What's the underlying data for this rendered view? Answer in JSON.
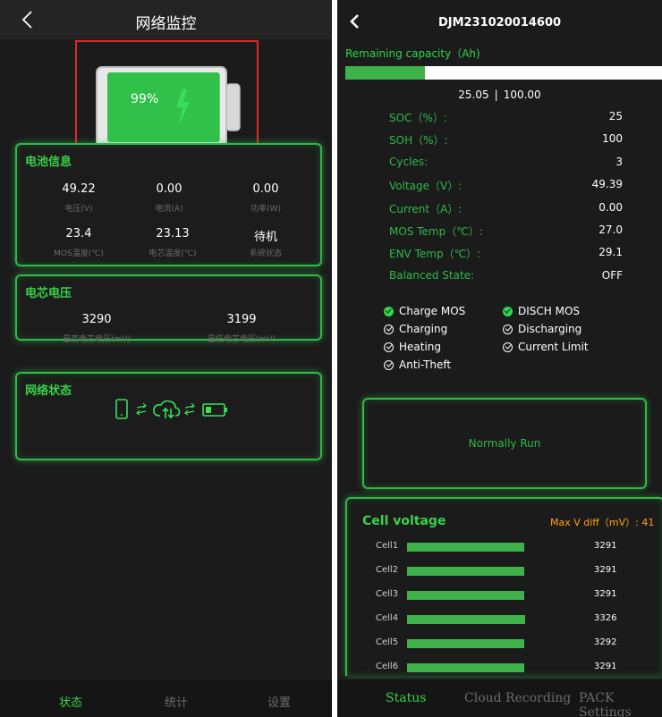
{
  "left": {
    "header": {
      "title": "网络监控"
    },
    "battery": {
      "percent_text": "99%",
      "fill_fraction": 0.99
    },
    "battery_info": {
      "title": "电池信息",
      "items": [
        {
          "value": "49.22",
          "label": "电压(V)"
        },
        {
          "value": "0.00",
          "label": "电流(A)"
        },
        {
          "value": "0.00",
          "label": "功率(W)"
        },
        {
          "value": "23.4",
          "label": "MOS温度(℃)"
        },
        {
          "value": "23.13",
          "label": "电芯温度(℃)"
        },
        {
          "value": "待机",
          "label": "系统状态"
        }
      ]
    },
    "cell_voltage": {
      "title": "电芯电压",
      "items": [
        {
          "value": "3290",
          "label": "最高电芯电压(mV)"
        },
        {
          "value": "3199",
          "label": "最低电芯电压(mV)"
        }
      ]
    },
    "network": {
      "title": "网络状态",
      "icons": [
        "phone-icon",
        "arrows-icon",
        "cloud-sync-icon",
        "arrows-icon",
        "battery-icon"
      ]
    },
    "tabs": [
      {
        "label": "状态",
        "active": true
      },
      {
        "label": "统计",
        "active": false
      },
      {
        "label": "设置",
        "active": false
      }
    ]
  },
  "right": {
    "header": {
      "title": "DJM231020014600"
    },
    "remaining": {
      "label": "Remaining capacity（Ah)",
      "current": "25.05",
      "separator": "|",
      "total": "100.00",
      "fraction": 0.25
    },
    "metrics": [
      {
        "label": "SOC（%）:",
        "value": "25"
      },
      {
        "label": "SOH（%）:",
        "value": "100"
      },
      {
        "label": "Cycles:",
        "value": "3"
      },
      {
        "label": "Voltage（V）:",
        "value": "49.39"
      },
      {
        "label": "Current（A）:",
        "value": "0.00"
      },
      {
        "label": "MOS Temp（℃）:",
        "value": "27.0"
      },
      {
        "label": "ENV Temp（℃）:",
        "value": "29.1"
      },
      {
        "label": "Balanced State:",
        "value": "OFF"
      }
    ],
    "flags": [
      {
        "label": "Charge MOS",
        "on": true
      },
      {
        "label": "DISCH MOS",
        "on": true
      },
      {
        "label": "Charging",
        "on": false
      },
      {
        "label": "Discharging",
        "on": false
      },
      {
        "label": "Heating",
        "on": false
      },
      {
        "label": "Current Limit",
        "on": false
      },
      {
        "label": "Anti-Theft",
        "on": false
      }
    ],
    "run_status": "Normally Run",
    "cell_voltage": {
      "title": "Cell voltage",
      "max_diff": "Max V diff（mV）: 41",
      "cells": [
        {
          "name": "Cell1",
          "value": "3291"
        },
        {
          "name": "Cell2",
          "value": "3291"
        },
        {
          "name": "Cell3",
          "value": "3291"
        },
        {
          "name": "Cell4",
          "value": "3326"
        },
        {
          "name": "Cell5",
          "value": "3292"
        },
        {
          "name": "Cell6",
          "value": "3291"
        }
      ]
    },
    "tabs": [
      {
        "label": "Status",
        "active": true
      },
      {
        "label": "Cloud Recording",
        "active": false
      },
      {
        "label": "PACK Settings",
        "active": false
      }
    ]
  },
  "colors": {
    "accent": "#2fb94a",
    "text_dim": "#6b6b6b",
    "highlight": "#e02a1f",
    "warning": "#ffa21a",
    "tab_active": "#37d24b",
    "tab_inactive": "#6b6b6b"
  }
}
